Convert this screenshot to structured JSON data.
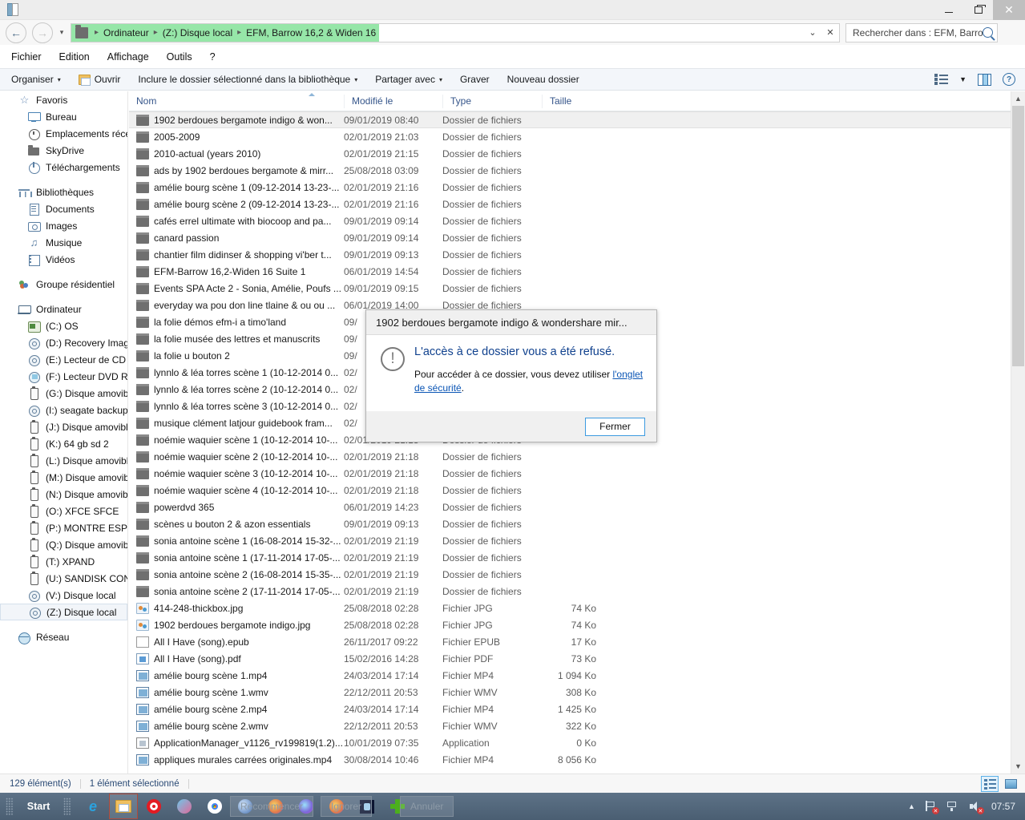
{
  "window": {
    "icon": "explorer-icon",
    "buttons": {
      "minimize": "–",
      "maximize": "❐",
      "close": "✕"
    }
  },
  "address": {
    "back": "←",
    "forward": "→",
    "history_dropdown": "▾",
    "crumbs": [
      "Ordinateur",
      "(Z:) Disque local",
      "EFM, Barrow 16,2 & Widen 16"
    ],
    "dropdown": "⌄",
    "refresh": "✕",
    "highlight_color": "#96e6a8"
  },
  "search": {
    "placeholder": "Rechercher dans : EFM, Barro...",
    "icon": "search-icon"
  },
  "menubar": {
    "items": [
      "Fichier",
      "Edition",
      "Affichage",
      "Outils",
      "?"
    ]
  },
  "toolbar": {
    "organize": "Organiser",
    "open": "Ouvrir",
    "include": "Inclure le dossier sélectionné dans la bibliothèque",
    "share": "Partager avec",
    "burn": "Graver",
    "new_folder": "Nouveau dossier",
    "caret": "▾",
    "view_icon": "list-view-icon",
    "pane_icon": "preview-pane-icon",
    "help_icon": "help-icon"
  },
  "sidebar": {
    "groups": [
      {
        "label": "Favoris",
        "icon": "star-icon",
        "cls": "ic-star",
        "glyph": "☆",
        "children": [
          {
            "label": "Bureau",
            "icon": "desktop-icon",
            "cls": "ic-desktop"
          },
          {
            "label": "Emplacements récen",
            "icon": "recent-places-icon",
            "cls": "ic-recent"
          },
          {
            "label": "SkyDrive",
            "icon": "skydrive-folder-icon",
            "cls": "ic-folderg"
          },
          {
            "label": "Téléchargements",
            "icon": "downloads-icon",
            "cls": "ic-dl"
          }
        ]
      },
      {
        "label": "Bibliothèques",
        "icon": "libraries-icon",
        "cls": "ic-lib",
        "children": [
          {
            "label": "Documents",
            "icon": "documents-icon",
            "cls": "ic-doc"
          },
          {
            "label": "Images",
            "icon": "pictures-icon",
            "cls": "ic-img"
          },
          {
            "label": "Musique",
            "icon": "music-icon",
            "cls": "ic-mus",
            "glyph": "♫"
          },
          {
            "label": "Vidéos",
            "icon": "videos-icon",
            "cls": "ic-vid"
          }
        ]
      },
      {
        "label": "Groupe résidentiel",
        "icon": "homegroup-icon",
        "cls": "ic-hg",
        "children": []
      },
      {
        "label": "Ordinateur",
        "icon": "computer-icon",
        "cls": "ic-pc",
        "children": [
          {
            "label": "(C:) OS",
            "icon": "os-drive-icon",
            "cls": "ic-osdrv"
          },
          {
            "label": "(D:) Recovery Image",
            "icon": "drive-icon",
            "cls": "ic-drv"
          },
          {
            "label": "(E:) Lecteur de CD - ",
            "icon": "cd-drive-icon",
            "cls": "ic-drv"
          },
          {
            "label": "(F:) Lecteur DVD RW",
            "icon": "dvd-drive-icon",
            "cls": "ic-dvd"
          },
          {
            "label": "(G:) Disque amovible",
            "icon": "removable-drive-icon",
            "cls": "ic-usb"
          },
          {
            "label": "(I:) seagate backup p",
            "icon": "drive-icon",
            "cls": "ic-drv"
          },
          {
            "label": "(J:) Disque amovible",
            "icon": "removable-drive-icon",
            "cls": "ic-usb"
          },
          {
            "label": "(K:) 64 gb sd 2",
            "icon": "removable-drive-icon",
            "cls": "ic-usb"
          },
          {
            "label": "(L:) Disque amovible",
            "icon": "removable-drive-icon",
            "cls": "ic-usb"
          },
          {
            "label": "(M:) Disque amovibl",
            "icon": "removable-drive-icon",
            "cls": "ic-usb"
          },
          {
            "label": "(N:) Disque amovibl",
            "icon": "removable-drive-icon",
            "cls": "ic-usb"
          },
          {
            "label": "(O:) XFCE SFCE",
            "icon": "removable-drive-icon",
            "cls": "ic-usb"
          },
          {
            "label": "(P:) MONTRE ESPI",
            "icon": "removable-drive-icon",
            "cls": "ic-usb"
          },
          {
            "label": "(Q:) Disque amovibl",
            "icon": "removable-drive-icon",
            "cls": "ic-usb"
          },
          {
            "label": "(T:) XPAND",
            "icon": "removable-drive-icon",
            "cls": "ic-usb"
          },
          {
            "label": "(U:) SANDISK CON",
            "icon": "removable-drive-icon",
            "cls": "ic-usb"
          },
          {
            "label": "(V:) Disque local",
            "icon": "drive-icon",
            "cls": "ic-drv"
          },
          {
            "label": "(Z:) Disque local",
            "icon": "drive-icon",
            "cls": "ic-drv",
            "selected": true
          }
        ]
      },
      {
        "label": "Réseau",
        "icon": "network-icon",
        "cls": "ic-net",
        "children": []
      }
    ]
  },
  "columns": {
    "name": "Nom",
    "modified": "Modifié le",
    "type": "Type",
    "size": "Taille"
  },
  "files": [
    {
      "name": "1902 berdoues bergamote indigo & won...",
      "modified": "09/01/2019 08:40",
      "type": "Dossier de fichiers",
      "size": "",
      "icon": "folder",
      "selected": true
    },
    {
      "name": "2005-2009",
      "modified": "02/01/2019 21:03",
      "type": "Dossier de fichiers",
      "size": "",
      "icon": "folder"
    },
    {
      "name": "2010-actual (years 2010)",
      "modified": "02/01/2019 21:15",
      "type": "Dossier de fichiers",
      "size": "",
      "icon": "folder"
    },
    {
      "name": "ads by 1902 berdoues bergamote & mirr...",
      "modified": "25/08/2018 03:09",
      "type": "Dossier de fichiers",
      "size": "",
      "icon": "folder"
    },
    {
      "name": "amélie bourg scène 1 (09-12-2014 13-23-...",
      "modified": "02/01/2019 21:16",
      "type": "Dossier de fichiers",
      "size": "",
      "icon": "folder"
    },
    {
      "name": "amélie bourg scène 2 (09-12-2014 13-23-...",
      "modified": "02/01/2019 21:16",
      "type": "Dossier de fichiers",
      "size": "",
      "icon": "folder"
    },
    {
      "name": "cafés errel ultimate with biocoop and pa...",
      "modified": "09/01/2019 09:14",
      "type": "Dossier de fichiers",
      "size": "",
      "icon": "folder"
    },
    {
      "name": "canard passion",
      "modified": "09/01/2019 09:14",
      "type": "Dossier de fichiers",
      "size": "",
      "icon": "folder"
    },
    {
      "name": "chantier film didinser & shopping vi'ber t...",
      "modified": "09/01/2019 09:13",
      "type": "Dossier de fichiers",
      "size": "",
      "icon": "folder"
    },
    {
      "name": "EFM-Barrow 16,2-Widen 16 Suite 1",
      "modified": "06/01/2019 14:54",
      "type": "Dossier de fichiers",
      "size": "",
      "icon": "folder"
    },
    {
      "name": "Events SPA Acte 2 - Sonia, Amélie, Poufs ...",
      "modified": "09/01/2019 09:15",
      "type": "Dossier de fichiers",
      "size": "",
      "icon": "folder"
    },
    {
      "name": "everyday wa pou don line tlaine & ou ou ...",
      "modified": "06/01/2019 14:00",
      "type": "Dossier de fichiers",
      "size": "",
      "icon": "folder"
    },
    {
      "name": "la folie démos efm-i a timo'land",
      "modified": "09/",
      "type": "",
      "size": "",
      "icon": "folder"
    },
    {
      "name": "la folie musée des lettres et manuscrits",
      "modified": "09/",
      "type": "",
      "size": "",
      "icon": "folder"
    },
    {
      "name": "la folie u bouton 2",
      "modified": "09/",
      "type": "",
      "size": "",
      "icon": "folder"
    },
    {
      "name": "lynnlo & léa torres scène 1 (10-12-2014 0...",
      "modified": "02/",
      "type": "",
      "size": "",
      "icon": "folder"
    },
    {
      "name": "lynnlo & léa torres scène 2 (10-12-2014 0...",
      "modified": "02/",
      "type": "",
      "size": "",
      "icon": "folder"
    },
    {
      "name": "lynnlo & léa torres scène 3 (10-12-2014 0...",
      "modified": "02/",
      "type": "",
      "size": "",
      "icon": "folder"
    },
    {
      "name": "musique clément latjour guidebook fram...",
      "modified": "02/",
      "type": "",
      "size": "",
      "icon": "folder"
    },
    {
      "name": "noémie waquier scène 1 (10-12-2014 10-...",
      "modified": "02/01/2019 21:18",
      "type": "Dossier de fichiers",
      "size": "",
      "icon": "folder"
    },
    {
      "name": "noémie waquier scène 2 (10-12-2014 10-...",
      "modified": "02/01/2019 21:18",
      "type": "Dossier de fichiers",
      "size": "",
      "icon": "folder"
    },
    {
      "name": "noémie waquier scène 3 (10-12-2014 10-...",
      "modified": "02/01/2019 21:18",
      "type": "Dossier de fichiers",
      "size": "",
      "icon": "folder"
    },
    {
      "name": "noémie waquier scène 4 (10-12-2014 10-...",
      "modified": "02/01/2019 21:18",
      "type": "Dossier de fichiers",
      "size": "",
      "icon": "folder"
    },
    {
      "name": "powerdvd 365",
      "modified": "06/01/2019 14:23",
      "type": "Dossier de fichiers",
      "size": "",
      "icon": "folder"
    },
    {
      "name": "scènes u bouton 2 & azon essentials",
      "modified": "09/01/2019 09:13",
      "type": "Dossier de fichiers",
      "size": "",
      "icon": "folder"
    },
    {
      "name": "sonia antoine scène 1 (16-08-2014 15-32-...",
      "modified": "02/01/2019 21:19",
      "type": "Dossier de fichiers",
      "size": "",
      "icon": "folder"
    },
    {
      "name": "sonia antoine scène 1 (17-11-2014 17-05-...",
      "modified": "02/01/2019 21:19",
      "type": "Dossier de fichiers",
      "size": "",
      "icon": "folder"
    },
    {
      "name": "sonia antoine scène 2 (16-08-2014 15-35-...",
      "modified": "02/01/2019 21:19",
      "type": "Dossier de fichiers",
      "size": "",
      "icon": "folder"
    },
    {
      "name": "sonia antoine scène 2 (17-11-2014 17-05-...",
      "modified": "02/01/2019 21:19",
      "type": "Dossier de fichiers",
      "size": "",
      "icon": "folder"
    },
    {
      "name": "414-248-thickbox.jpg",
      "modified": "25/08/2018 02:28",
      "type": "Fichier JPG",
      "size": "74 Ko",
      "icon": "jpg"
    },
    {
      "name": "1902 berdoues bergamote indigo.jpg",
      "modified": "25/08/2018 02:28",
      "type": "Fichier JPG",
      "size": "74 Ko",
      "icon": "jpg"
    },
    {
      "name": "All I Have (song).epub",
      "modified": "26/11/2017 09:22",
      "type": "Fichier EPUB",
      "size": "17 Ko",
      "icon": "epub"
    },
    {
      "name": "All I Have (song).pdf",
      "modified": "15/02/2016 14:28",
      "type": "Fichier PDF",
      "size": "73 Ko",
      "icon": "pdf"
    },
    {
      "name": "amélie bourg scène 1.mp4",
      "modified": "24/03/2014 17:14",
      "type": "Fichier MP4",
      "size": "1 094 Ko",
      "icon": "vid"
    },
    {
      "name": "amélie bourg scène 1.wmv",
      "modified": "22/12/2011 20:53",
      "type": "Fichier WMV",
      "size": "308 Ko",
      "icon": "vid"
    },
    {
      "name": "amélie bourg scène 2.mp4",
      "modified": "24/03/2014 17:14",
      "type": "Fichier MP4",
      "size": "1 425 Ko",
      "icon": "vid"
    },
    {
      "name": "amélie bourg scène 2.wmv",
      "modified": "22/12/2011 20:53",
      "type": "Fichier WMV",
      "size": "322 Ko",
      "icon": "vid"
    },
    {
      "name": "ApplicationManager_v1126_rv199819(1.2)...",
      "modified": "10/01/2019 07:35",
      "type": "Application",
      "size": "0 Ko",
      "icon": "app"
    },
    {
      "name": "appliques murales carrées originales.mp4",
      "modified": "30/08/2014 10:46",
      "type": "Fichier MP4",
      "size": "8 056 Ko",
      "icon": "vid"
    }
  ],
  "dialog": {
    "title": "1902 berdoues bergamote indigo & wondershare mir...",
    "icon": "warning-icon",
    "heading": "L'accès à ce dossier vous a été refusé.",
    "body_prefix": "Pour accéder à ce dossier, vous devez utiliser ",
    "link": "l'onglet de sécurité",
    "body_suffix": ".",
    "close_button": "Fermer"
  },
  "statusbar": {
    "count": "129 élément(s)",
    "selection": "1 élément sélectionné",
    "details_view_icon": "details-view-icon",
    "thumbnail_view_icon": "thumbnail-view-icon"
  },
  "taskbar": {
    "start": "Start",
    "apps": [
      "internet-explorer-icon",
      "explorer-icon",
      "opera-icon",
      "maxthon-icon",
      "chrome-icon",
      "globe-icon",
      "firefox-icon",
      "firefox-purple-icon",
      "firefox-icon-2",
      "app-icon",
      "add-icon"
    ],
    "ghost_buttons": [
      "Recommencer",
      "Ignorer",
      "Annuler"
    ],
    "tray": {
      "show_hidden": "▲",
      "flag_icon": "action-center-flag-icon",
      "network_icon": "network-icon",
      "volume_icon": "volume-icon",
      "clock": "07:57"
    }
  }
}
